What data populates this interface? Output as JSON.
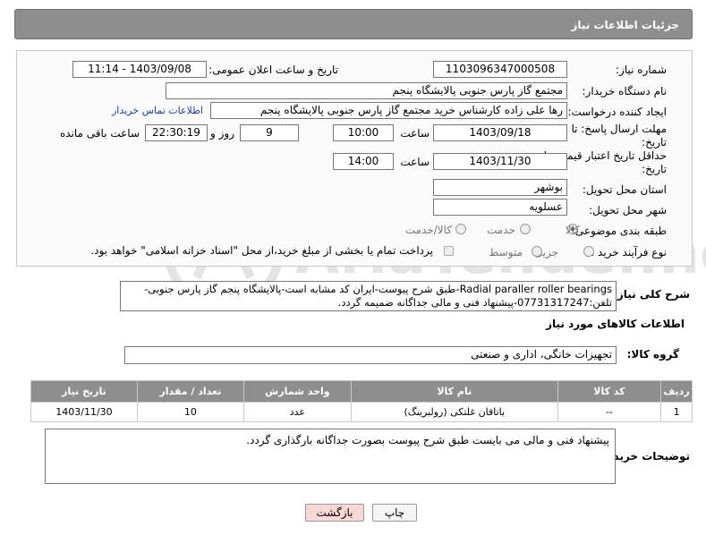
{
  "header": {
    "title": "جزئیات اطلاعات نیاز"
  },
  "fields": {
    "need_number_label": "شماره نیاز:",
    "need_number": "1103096347000508",
    "announce_label": "تاریخ و ساعت اعلان عمومی:",
    "announce_value": "1403/09/08 - 11:14",
    "buyer_org_label": "نام دستگاه خریدار:",
    "buyer_org": "مجتمع گاز پارس جنوبی  پالایشگاه پنجم",
    "creator_label": "ایجاد کننده درخواست:",
    "creator": "رها علی زاده کارشناس خرید مجتمع گاز پارس جنوبی  پالایشگاه پنجم",
    "contact_link": "اطلاعات تماس خریدار",
    "deadline_label_1": "مهلت ارسال پاسخ: تا",
    "deadline_label_2": "تاریخ:",
    "deadline_date": "1403/09/18",
    "time_label": "ساعت",
    "deadline_time": "10:00",
    "days_value": "9",
    "days_label": "روز و",
    "remaining_value": "22:30:19",
    "remaining_label": "ساعت باقی مانده",
    "validity_label_1": "حداقل تاریخ اعتبار قیمت: تا",
    "validity_label_2": "تاریخ:",
    "validity_date": "1403/11/30",
    "validity_time": "14:00",
    "province_label": "استان محل تحویل:",
    "province": "بوشهر",
    "city_label": "شهر محل تحویل:",
    "city": "عسلویه",
    "category_label": "طبقه بندی موضوعی:",
    "category_options": [
      "کالا",
      "خدمت",
      "کالا/خدمت"
    ],
    "process_label": "نوع فرآیند خرید :",
    "process_options": [
      "جزیی",
      "متوسط"
    ],
    "process_note": "پرداخت تمام یا بخشی از مبلغ خرید،از محل \"اسناد خزانه اسلامی\" خواهد بود."
  },
  "description": {
    "label": "شرح کلی نیاز:",
    "text": "Radial paraller roller bearings-طبق شرح پیوست-ایران کد مشابه است-پالایشگاه پنجم گاز پارس جنوبی-تلفن:07731317247-پیشنهاد فنی و مالی جداگانه ضمیمه گردد."
  },
  "goods_section": {
    "title": "اطلاعات کالاهای مورد نیاز",
    "group_label": "گروه کالا:",
    "group_value": "تجهیزات خانگی، اداری و صنعتی"
  },
  "table": {
    "headers": [
      "ردیف",
      "کد کالا",
      "نام کالا",
      "واحد شمارش",
      "تعداد / مقدار",
      "تاریخ نیاز"
    ],
    "rows": [
      [
        "1",
        "--",
        "یاتاقان غلتکی (رولبرینگ)",
        "عدد",
        "10",
        "1403/11/30"
      ]
    ]
  },
  "buyer_notes": {
    "label": "توضیحات خریدار:",
    "text": "پیشنهاد فنی و مالی می بایست طبق شرح پیوست بصورت جداگانه بارگذاری گردد."
  },
  "buttons": {
    "print": "چاپ",
    "back": "بازگشت"
  },
  "watermark_text": "AriaTender.neT",
  "colors": {
    "header_bg": "#8e8e8e",
    "link": "#1a3fb0",
    "back_button_bg": "#f8d7d7"
  }
}
